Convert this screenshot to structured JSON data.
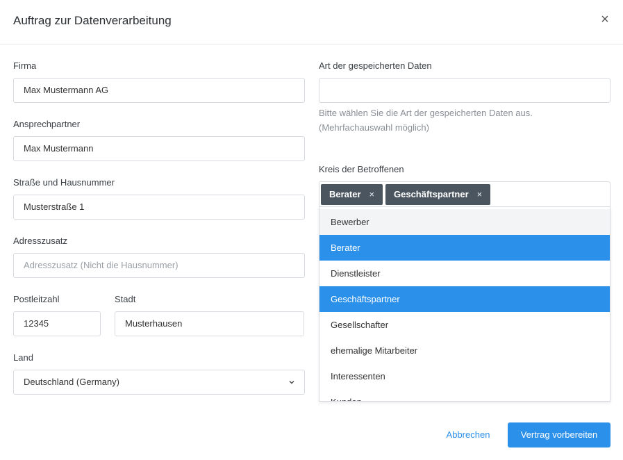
{
  "modal": {
    "title": "Auftrag zur Datenverarbeitung",
    "close_icon": "close-icon",
    "close_glyph": "×"
  },
  "form": {
    "firma": {
      "label": "Firma",
      "value": "Max Mustermann AG"
    },
    "ansprechpartner": {
      "label": "Ansprechpartner",
      "value": "Max Mustermann"
    },
    "strasse": {
      "label": "Straße und Hausnummer",
      "value": "Musterstraße 1"
    },
    "adresszusatz": {
      "label": "Adresszusatz",
      "value": "",
      "placeholder": "Adresszusatz (Nicht die Hausnummer)"
    },
    "plz": {
      "label": "Postleitzahl",
      "value": "12345"
    },
    "stadt": {
      "label": "Stadt",
      "value": "Musterhausen"
    },
    "land": {
      "label": "Land",
      "value": "Deutschland (Germany)"
    },
    "datenart": {
      "label": "Art der gespeicherten Daten",
      "value": "",
      "help_line1": "Bitte wählen Sie die Art der gespeicherten Daten aus.",
      "help_line2": "(Mehrfachauswahl möglich)"
    },
    "betroffene": {
      "label": "Kreis der Betroffenen",
      "tags": [
        {
          "label": "Berater",
          "remove": "×"
        },
        {
          "label": "Geschäftspartner",
          "remove": "×"
        }
      ],
      "options": [
        {
          "label": "Bewerber",
          "state": "hover"
        },
        {
          "label": "Berater",
          "state": "selected"
        },
        {
          "label": "Dienstleister",
          "state": "normal"
        },
        {
          "label": "Geschäftspartner",
          "state": "selected"
        },
        {
          "label": "Gesellschafter",
          "state": "normal"
        },
        {
          "label": "ehemalige Mitarbeiter",
          "state": "normal"
        },
        {
          "label": "Interessenten",
          "state": "normal"
        },
        {
          "label": "Kunden",
          "state": "normal"
        }
      ]
    }
  },
  "footer": {
    "cancel_label": "Abbrechen",
    "submit_label": "Vertrag vorbereiten"
  },
  "colors": {
    "accent": "#2b90e9",
    "tag_bg": "#4a555f",
    "option_hover": "#f3f4f5"
  }
}
